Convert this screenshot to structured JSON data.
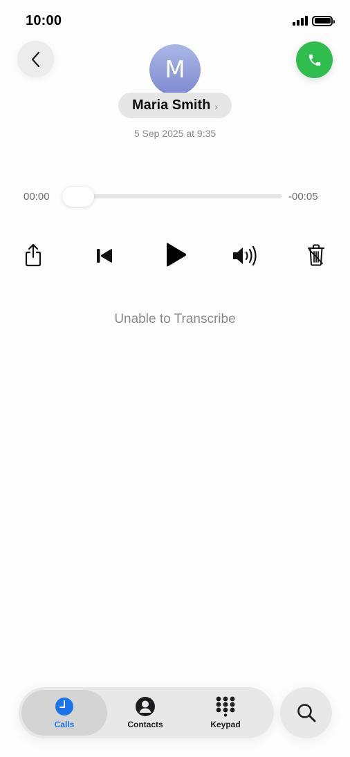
{
  "status_bar": {
    "time": "10:00"
  },
  "header": {
    "contact_initial": "M",
    "contact_name": "Maria Smith",
    "name_chevron": "›",
    "date": "5 Sep 2025 at 9:35"
  },
  "player": {
    "elapsed": "00:00",
    "remaining": "-00:05",
    "progress": 0
  },
  "transcript": {
    "status": "Unable to Transcribe"
  },
  "tabs": [
    {
      "label": "Calls",
      "icon": "clock-icon",
      "selected": true
    },
    {
      "label": "Contacts",
      "icon": "person-circle-icon",
      "selected": false
    },
    {
      "label": "Keypad",
      "icon": "keypad-grid-icon",
      "selected": false
    }
  ],
  "colors": {
    "accent": "#1a73e8",
    "call_green": "#2fbd4d",
    "avatar_top": "#aab8e6",
    "avatar_bottom": "#7e8ad0"
  },
  "icons": {
    "back": "chevron-left-icon",
    "call": "phone-icon",
    "share": "share-icon",
    "skip_back": "skip-back-icon",
    "play": "play-icon",
    "speaker": "speaker-icon",
    "delete": "trash-icon",
    "search": "search-icon"
  }
}
